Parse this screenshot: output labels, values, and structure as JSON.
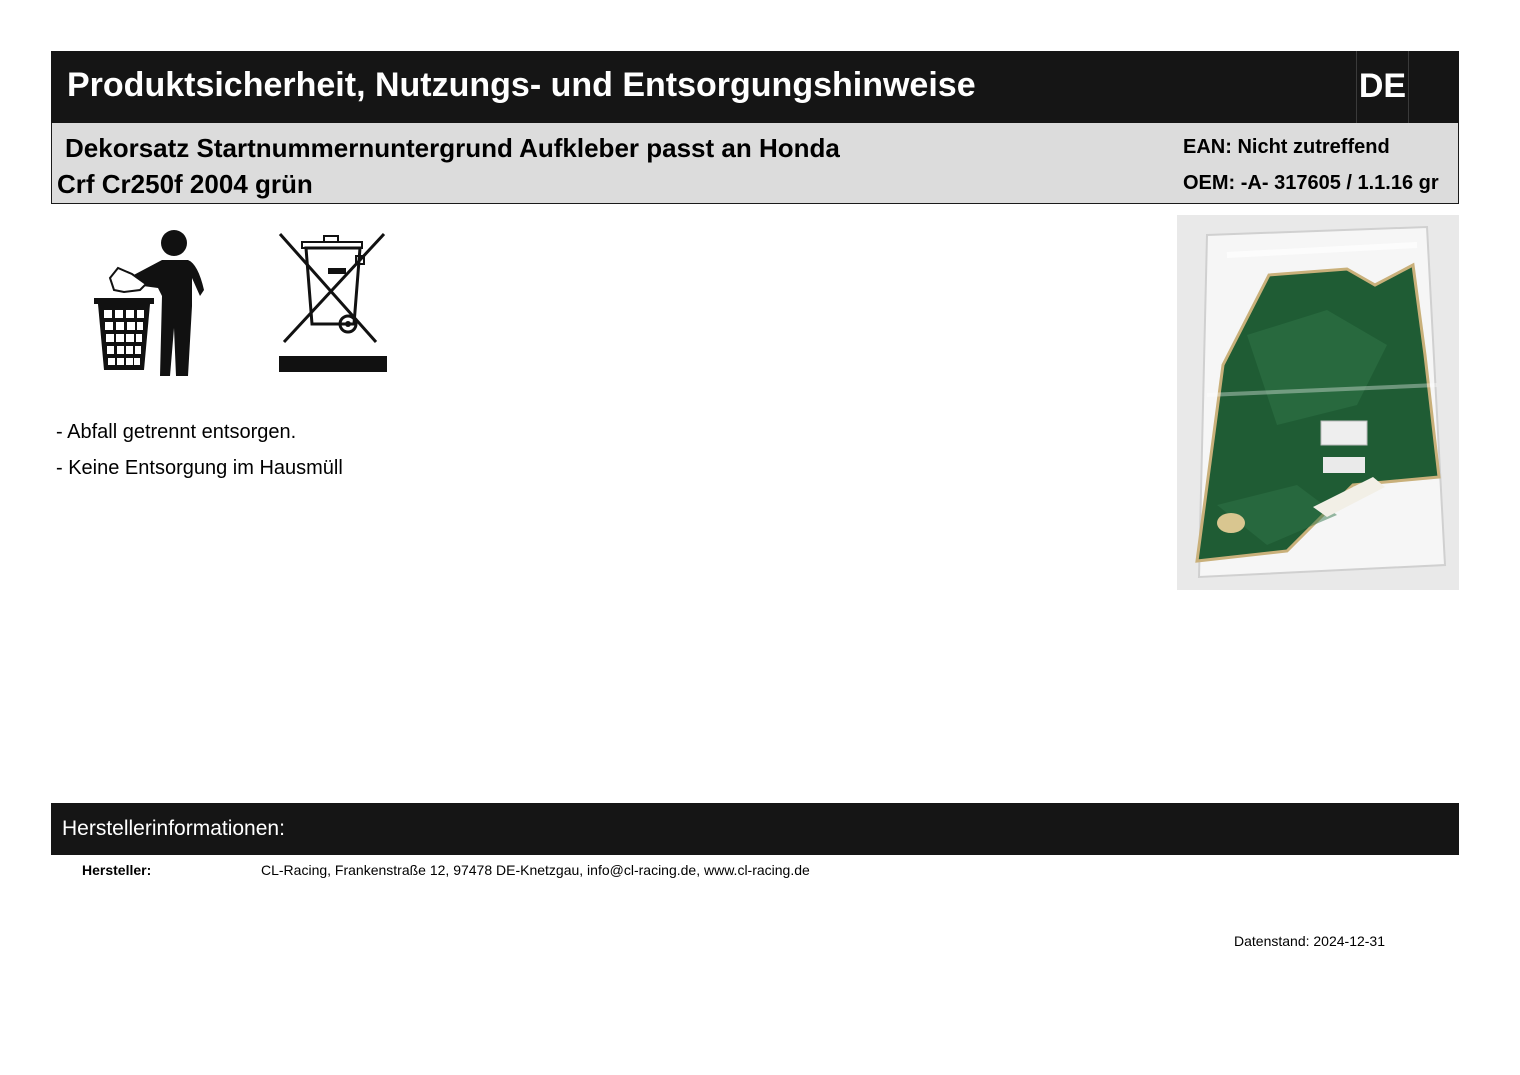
{
  "header": {
    "title": "Produktsicherheit, Nutzungs- und Entsorgungshinweise",
    "language": "DE"
  },
  "product": {
    "name_line1": "Dekorsatz Startnummernuntergrund Aufkleber passt an Honda",
    "name_line2": "Crf Cr250f 2004 grün",
    "ean": "EAN: Nicht zutreffend",
    "oem": "OEM: -A- 317605 / 1.1.16 gr"
  },
  "icons": [
    "tidy-man-icon",
    "weee-crossed-bin-icon"
  ],
  "notes": [
    "- Abfall getrennt entsorgen.",
    "- Keine Entsorgung im Hausmüll"
  ],
  "manufacturer": {
    "section_title": "Herstellerinformationen:",
    "label": "Hersteller:",
    "value": "CL-Racing, Frankenstraße 12, 97478 DE-Knetzgau, info@cl-racing.de, www.cl-racing.de"
  },
  "footer": {
    "date": "Datenstand: 2024-12-31"
  },
  "colors": {
    "dark_bar": "#151515",
    "product_bar": "#dcdcdc",
    "decal_green": "#1f5c34"
  }
}
